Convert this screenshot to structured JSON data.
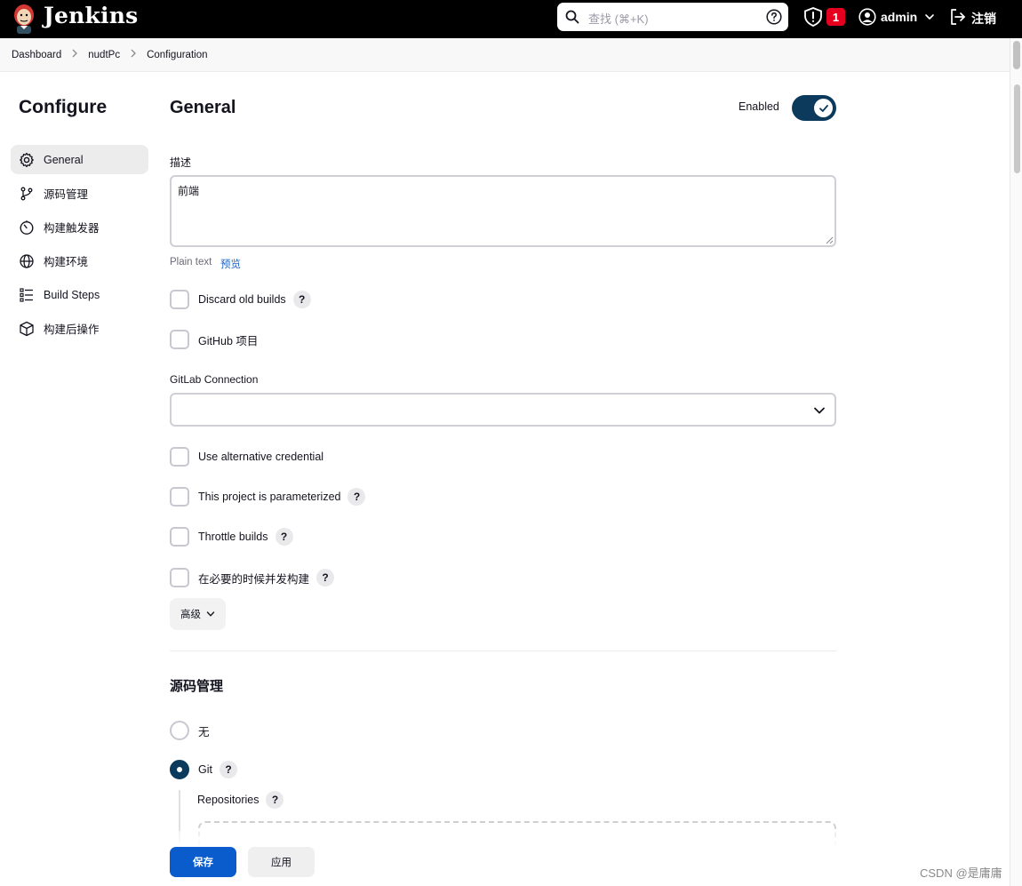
{
  "header": {
    "brand": "Jenkins",
    "search_placeholder": "查找 (⌘+K)",
    "security_count": "1",
    "username": "admin",
    "logout": "注销"
  },
  "breadcrumb": [
    "Dashboard",
    "nudtPc",
    "Configuration"
  ],
  "sidebar": {
    "title": "Configure",
    "items": [
      {
        "label": "General",
        "icon": "gear-icon"
      },
      {
        "label": "源码管理",
        "icon": "branch-icon"
      },
      {
        "label": "构建触发器",
        "icon": "timer-icon"
      },
      {
        "label": "构建环境",
        "icon": "globe-icon"
      },
      {
        "label": "Build Steps",
        "icon": "list-icon"
      },
      {
        "label": "构建后操作",
        "icon": "package-icon"
      }
    ]
  },
  "general": {
    "title": "General",
    "enabled_label": "Enabled",
    "enabled": true,
    "description_label": "描述",
    "description_value": "前端",
    "plain_text": "Plain text",
    "preview": "预览",
    "checks": [
      {
        "label": "Discard old builds",
        "help": true
      },
      {
        "label": "GitHub 项目",
        "help": false
      }
    ],
    "gitlab_label": "GitLab Connection",
    "gitlab_value": "",
    "checks2": [
      {
        "label": "Use alternative credential",
        "help": false
      },
      {
        "label": "This project is parameterized",
        "help": true
      },
      {
        "label": "Throttle builds",
        "help": true
      },
      {
        "label": "在必要的时候并发构建",
        "help": true
      }
    ],
    "advanced": "高级"
  },
  "scm": {
    "title": "源码管理",
    "none_label": "无",
    "git_label": "Git",
    "repositories_label": "Repositories"
  },
  "actions": {
    "save": "保存",
    "apply": "应用"
  },
  "help_glyph": "?",
  "watermark": "CSDN @是庸庸",
  "colors": {
    "header_bg": "#000000",
    "accent": "#0b3a5c",
    "primary_button": "#0a5ccc",
    "badge": "#e6001f",
    "link": "#1c62c4"
  }
}
